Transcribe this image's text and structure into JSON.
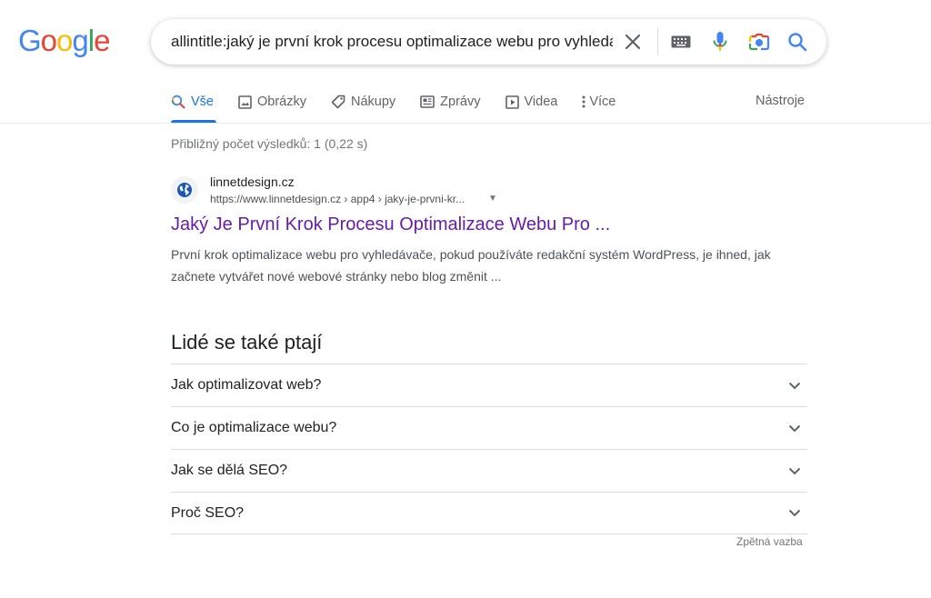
{
  "logo": {
    "text": "Google"
  },
  "search": {
    "value": "allintitle:jaký je první krok procesu optimalizace webu pro vyhledávače",
    "clear_icon": "close-icon",
    "keyboard_icon": "keyboard-icon",
    "voice_icon": "mic-icon",
    "lens_icon": "camera-icon",
    "submit_icon": "search-icon"
  },
  "tabs": [
    {
      "label": "Vše",
      "icon": "search-icon",
      "active": true
    },
    {
      "label": "Obrázky",
      "icon": "image-icon"
    },
    {
      "label": "Nákupy",
      "icon": "tag-icon"
    },
    {
      "label": "Zprávy",
      "icon": "news-icon"
    },
    {
      "label": "Videa",
      "icon": "play-icon"
    },
    {
      "label": "Více",
      "icon": "more-vert-icon"
    }
  ],
  "tools_label": "Nástroje",
  "stats": "Přibližný počet výsledků: 1 (0,22 s)",
  "result": {
    "site_name": "linnetdesign.cz",
    "url": "https://www.linnetdesign.cz › app4 › jaky-je-prvni-kr...",
    "favicon": "globe-icon",
    "title": "Jaký Je První Krok Procesu Optimalizace Webu Pro ...",
    "snippet": "První krok optimalizace webu pro vyhledávače, pokud používáte redakční systém WordPress, je ihned, jak začnete vytvářet nové webové stránky nebo blog změnit ..."
  },
  "paa": {
    "title": "Lidé se také ptají",
    "questions": [
      "Jak optimalizovat web?",
      "Co je optimalizace webu?",
      "Jak se dělá SEO?",
      "Proč SEO?"
    ],
    "feedback": "Zpětná vazba"
  },
  "colors": {
    "accent": "#1a73e8",
    "visited_link": "#681da8",
    "muted": "#70757a"
  }
}
